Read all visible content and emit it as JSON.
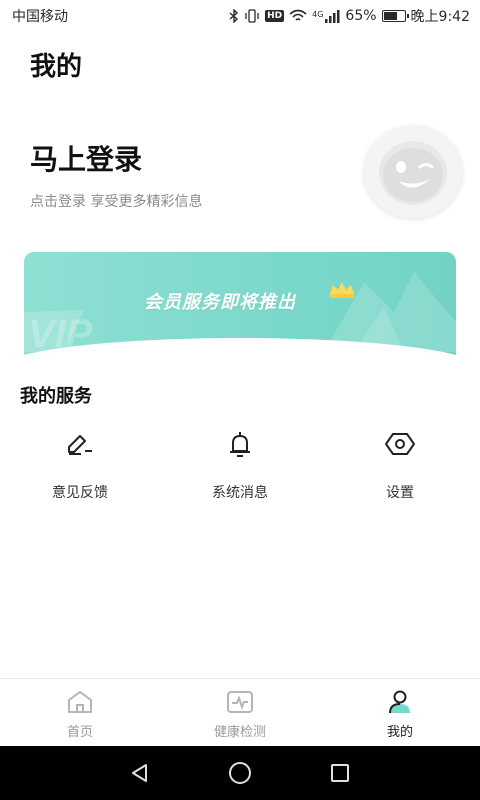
{
  "status_bar": {
    "carrier": "中国移动",
    "network": "4G",
    "battery": "65%",
    "battery_level": 0.65,
    "time": "晚上9:42",
    "hd": "HD"
  },
  "page": {
    "title": "我的"
  },
  "login": {
    "title": "马上登录",
    "subtitle": "点击登录 享受更多精彩信息"
  },
  "vip_banner": {
    "text": "会员服务即将推出",
    "watermark": "VIP"
  },
  "services": {
    "title": "我的服务",
    "items": [
      {
        "label": "意见反馈",
        "icon": "feedback-pen-icon"
      },
      {
        "label": "系统消息",
        "icon": "bell-icon"
      },
      {
        "label": "设置",
        "icon": "hexagon-settings-icon"
      }
    ]
  },
  "tabbar": {
    "items": [
      {
        "label": "首页",
        "icon": "home-icon",
        "active": false
      },
      {
        "label": "健康检测",
        "icon": "health-monitor-icon",
        "active": false
      },
      {
        "label": "我的",
        "icon": "user-icon",
        "active": true
      }
    ]
  },
  "colors": {
    "accent": "#7ad8ca",
    "text_primary": "#111111",
    "text_secondary": "#8a8a8a",
    "tab_inactive": "#9a9a9a"
  }
}
